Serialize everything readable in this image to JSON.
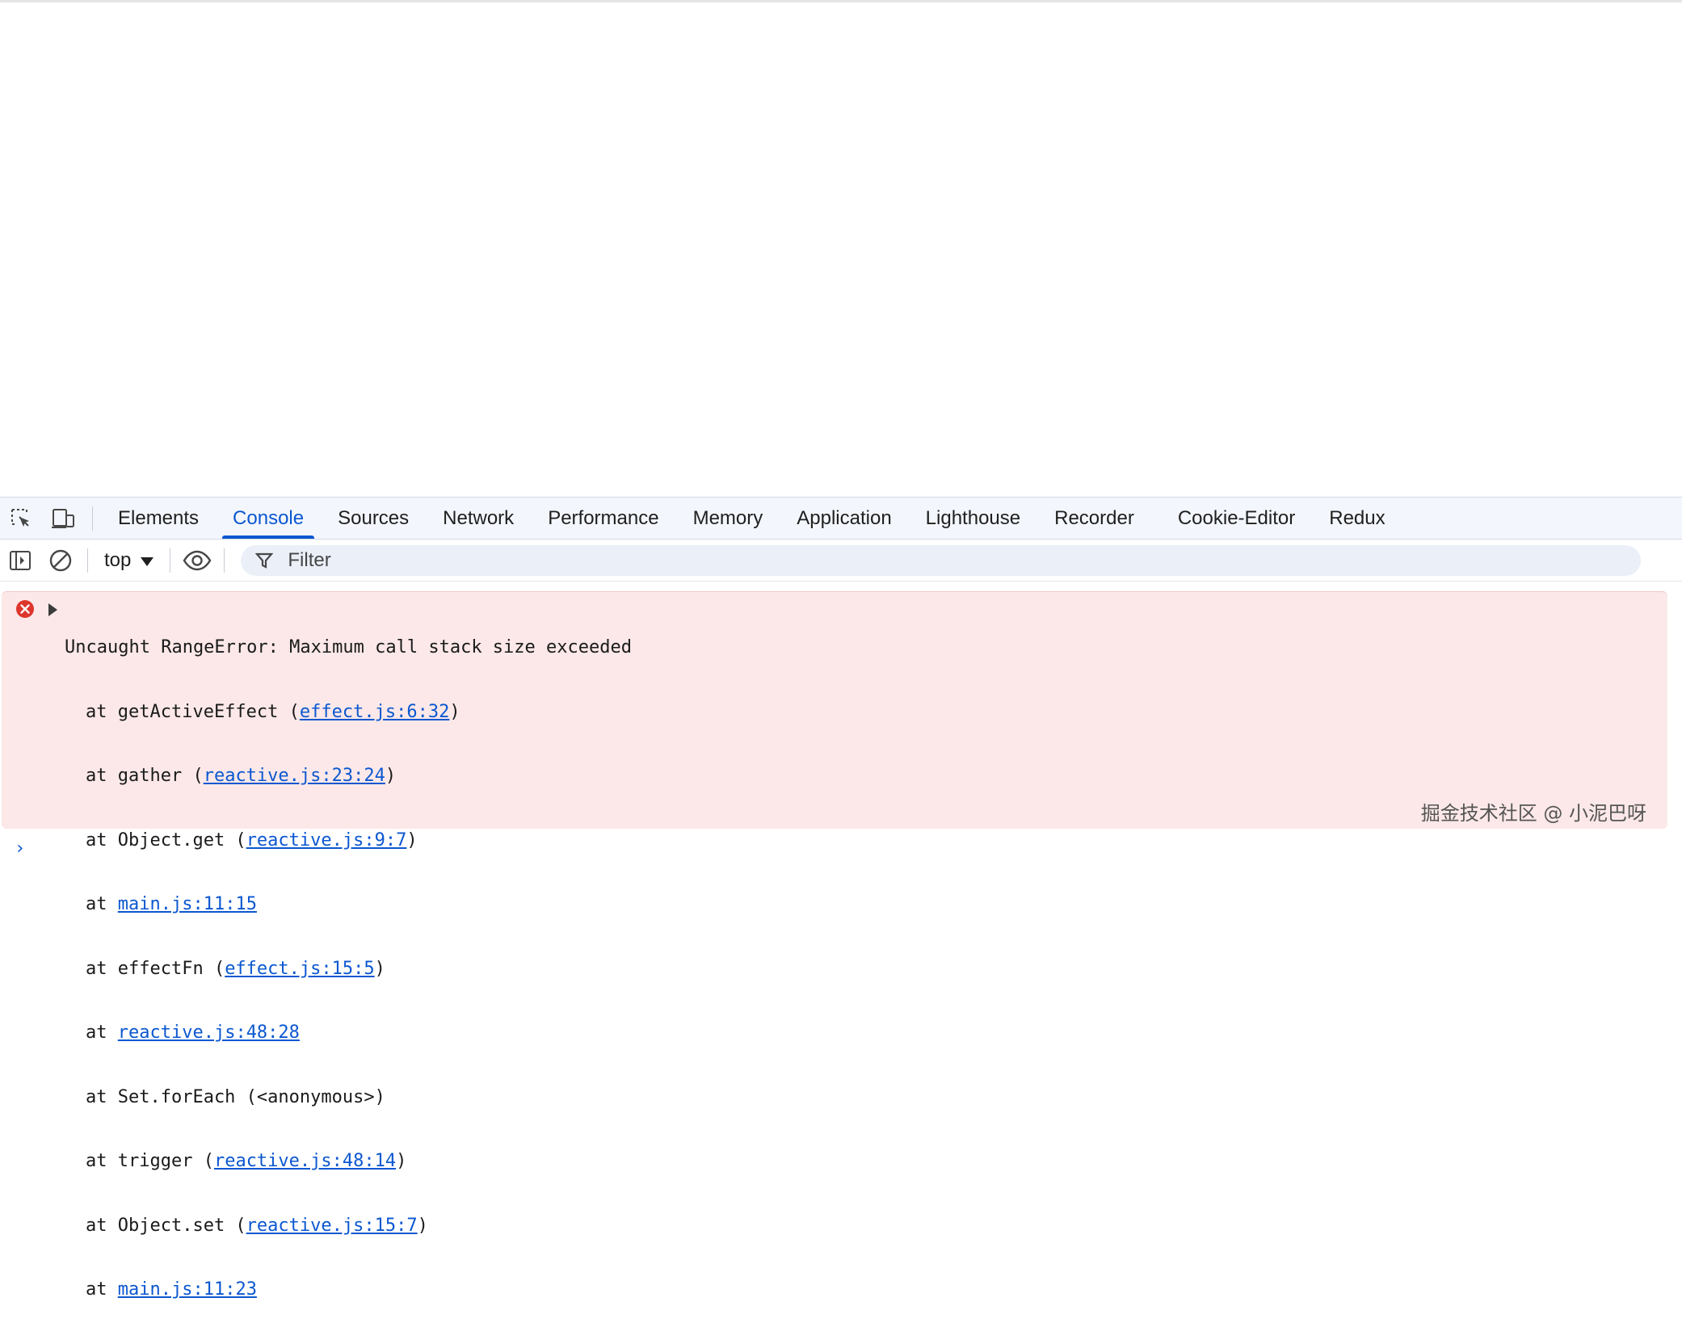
{
  "devtools": {
    "tabs": [
      "Elements",
      "Console",
      "Sources",
      "Network",
      "Performance",
      "Memory",
      "Application",
      "Lighthouse",
      "Recorder",
      "Cookie-Editor",
      "Redux"
    ],
    "active_tab": "Console"
  },
  "console_toolbar": {
    "context": "top",
    "filter_placeholder": "Filter"
  },
  "error": {
    "message": "Uncaught RangeError: Maximum call stack size exceeded",
    "stack": [
      {
        "prefix": "at getActiveEffect (",
        "link": "effect.js:6:32",
        "suffix": ")"
      },
      {
        "prefix": "at gather (",
        "link": "reactive.js:23:24",
        "suffix": ")"
      },
      {
        "prefix": "at Object.get (",
        "link": "reactive.js:9:7",
        "suffix": ")"
      },
      {
        "prefix": "at ",
        "link": "main.js:11:15",
        "suffix": ""
      },
      {
        "prefix": "at effectFn (",
        "link": "effect.js:15:5",
        "suffix": ")"
      },
      {
        "prefix": "at ",
        "link": "reactive.js:48:28",
        "suffix": ""
      },
      {
        "prefix": "at Set.forEach (<anonymous>)",
        "link": "",
        "suffix": ""
      },
      {
        "prefix": "at trigger (",
        "link": "reactive.js:48:14",
        "suffix": ")"
      },
      {
        "prefix": "at Object.set (",
        "link": "reactive.js:15:7",
        "suffix": ")"
      },
      {
        "prefix": "at ",
        "link": "main.js:11:23",
        "suffix": ""
      }
    ]
  },
  "watermark": "掘金技术社区 @ 小泥巴呀",
  "colors": {
    "accent": "#0b57d0",
    "error_bg": "#fce8e8",
    "error_icon": "#dc362e"
  }
}
